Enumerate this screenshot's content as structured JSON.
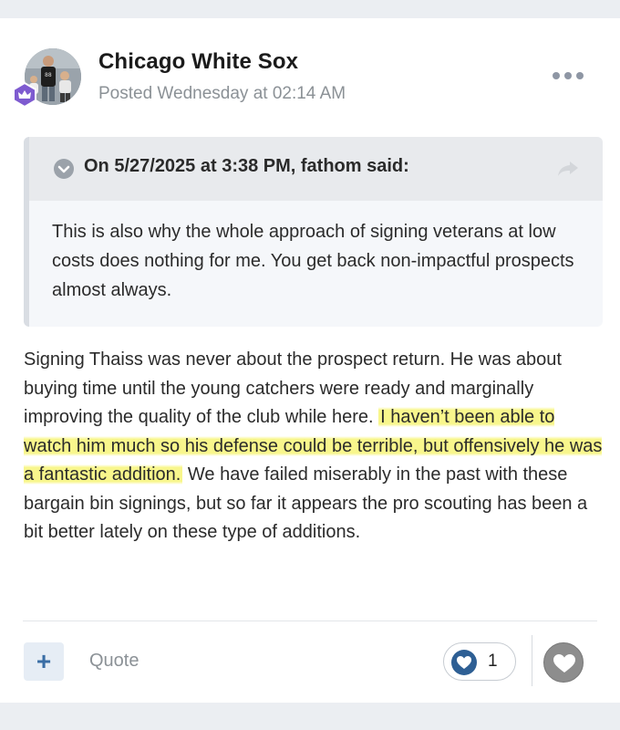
{
  "post": {
    "author": "Chicago White Sox",
    "posted": "Posted Wednesday at 02:14 AM",
    "avatar_icon": "user-avatar-photo",
    "badge_icon": "crown-badge-icon"
  },
  "quote": {
    "cite": "On 5/27/2025 at 3:38 PM, fathom said:",
    "text": "This is also why the whole approach of signing veterans at low costs does nothing for me.  You get back non-impactful prospects almost always."
  },
  "body": {
    "part1": "Signing Thaiss was never about the prospect return.  He was about buying time until the young catchers were ready and marginally improving the quality of the club while here.",
    "highlight": "I haven’t been able to watch him much so his defense could be terrible, but offensively he was a fantastic addition.",
    "part2": "We have failed miserably in the past with these bargain bin signings, but so far it appears the pro scouting has been a bit better lately on these type of additions."
  },
  "footer": {
    "plus_label": "+",
    "quote_label": "Quote",
    "reaction_count": "1"
  },
  "colors": {
    "highlight": "#f7f578",
    "accent": "#2e5f94"
  }
}
